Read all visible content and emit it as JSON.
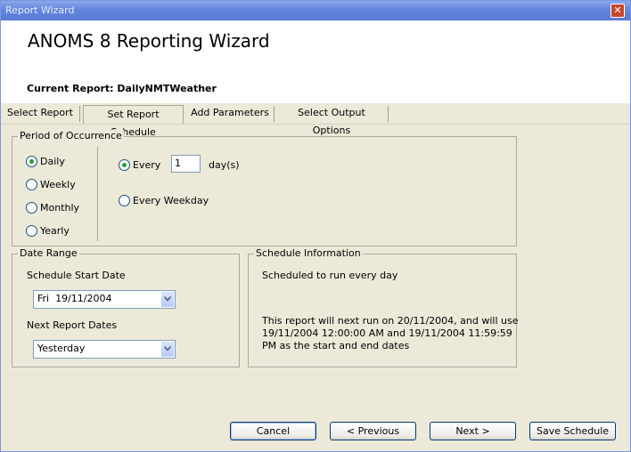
{
  "window": {
    "title": "Report Wizard",
    "close_label": "✕"
  },
  "header": {
    "app_title": "ANOMS 8 Reporting Wizard",
    "current_report": "Current Report: DailyNMTWeather"
  },
  "tabs": [
    {
      "label": "Select Report"
    },
    {
      "label": "Set Report Schedule"
    },
    {
      "label": "Add Parameters"
    },
    {
      "label": "Select Output Options"
    }
  ],
  "period": {
    "legend": "Period of Occurrence",
    "options": [
      {
        "label": "Daily",
        "checked": true
      },
      {
        "label": "Weekly",
        "checked": false
      },
      {
        "label": "Monthly",
        "checked": false
      },
      {
        "label": "Yearly",
        "checked": false
      }
    ],
    "every_label": "Every",
    "every_value": "1",
    "every_unit": "day(s)",
    "every_weekday_label": "Every Weekday"
  },
  "date_range": {
    "legend": "Date Range",
    "start_label": "Schedule Start Date",
    "start_value": "Fri  19/11/2004",
    "next_label": "Next Report Dates",
    "next_value": "Yesterday"
  },
  "schedule_info": {
    "legend": "Schedule Information",
    "line1": "Scheduled to run every day",
    "line2": "This report will next run on 20/11/2004, and will use",
    "line3": "19/11/2004 12:00:00 AM and 19/11/2004 11:59:59",
    "line4": "PM as the start and end dates"
  },
  "buttons": {
    "cancel": "Cancel",
    "previous": "< Previous",
    "next": "Next >",
    "save": "Save Schedule"
  }
}
